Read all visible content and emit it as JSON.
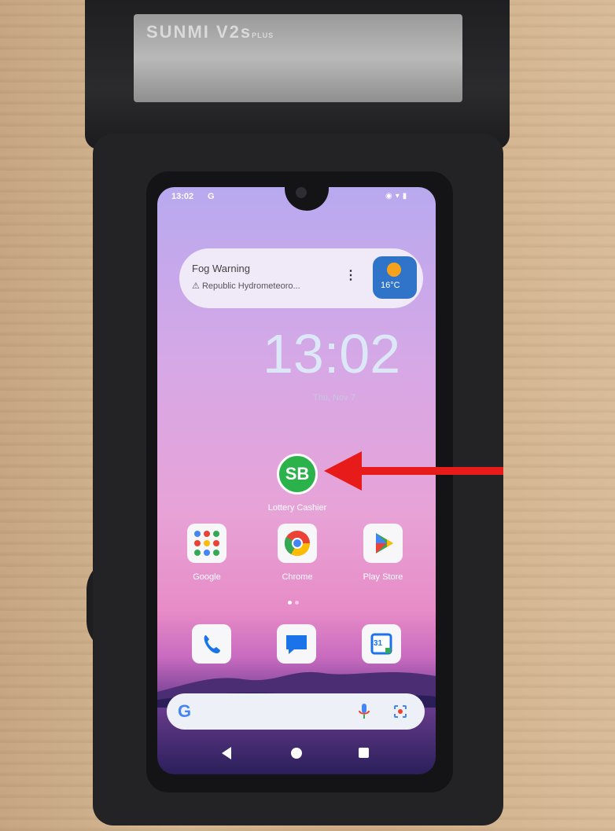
{
  "device": {
    "brand": "SUNMI V2s",
    "brand_suffix": "PLUS"
  },
  "status_bar": {
    "time": "13:02",
    "notification_icon": "G",
    "icons": [
      "wifi-icon",
      "signal-icon",
      "battery-icon"
    ]
  },
  "weather_widget": {
    "title": "Fog Warning",
    "subtitle": "Republic Hydrometeoro...",
    "warning_icon": "warning-triangle-icon",
    "menu_label": "⋮",
    "temperature": "16°C",
    "tile_color": "#2f74c9"
  },
  "clock": {
    "time": "13:02",
    "date": "Thu, Nov 7"
  },
  "featured_app": {
    "label": "Lottery Cashier",
    "icon_text": "SB",
    "color": "#2bb24a"
  },
  "apps_row": [
    {
      "label": "Google"
    },
    {
      "label": "Chrome"
    },
    {
      "label": "Play Store"
    }
  ],
  "dock": [
    "phone-icon",
    "messages-icon",
    "calendar-icon"
  ],
  "calendar_day": "31",
  "search": {
    "g_label": "G"
  },
  "annotation": {
    "arrow_color": "#e81b1b"
  }
}
